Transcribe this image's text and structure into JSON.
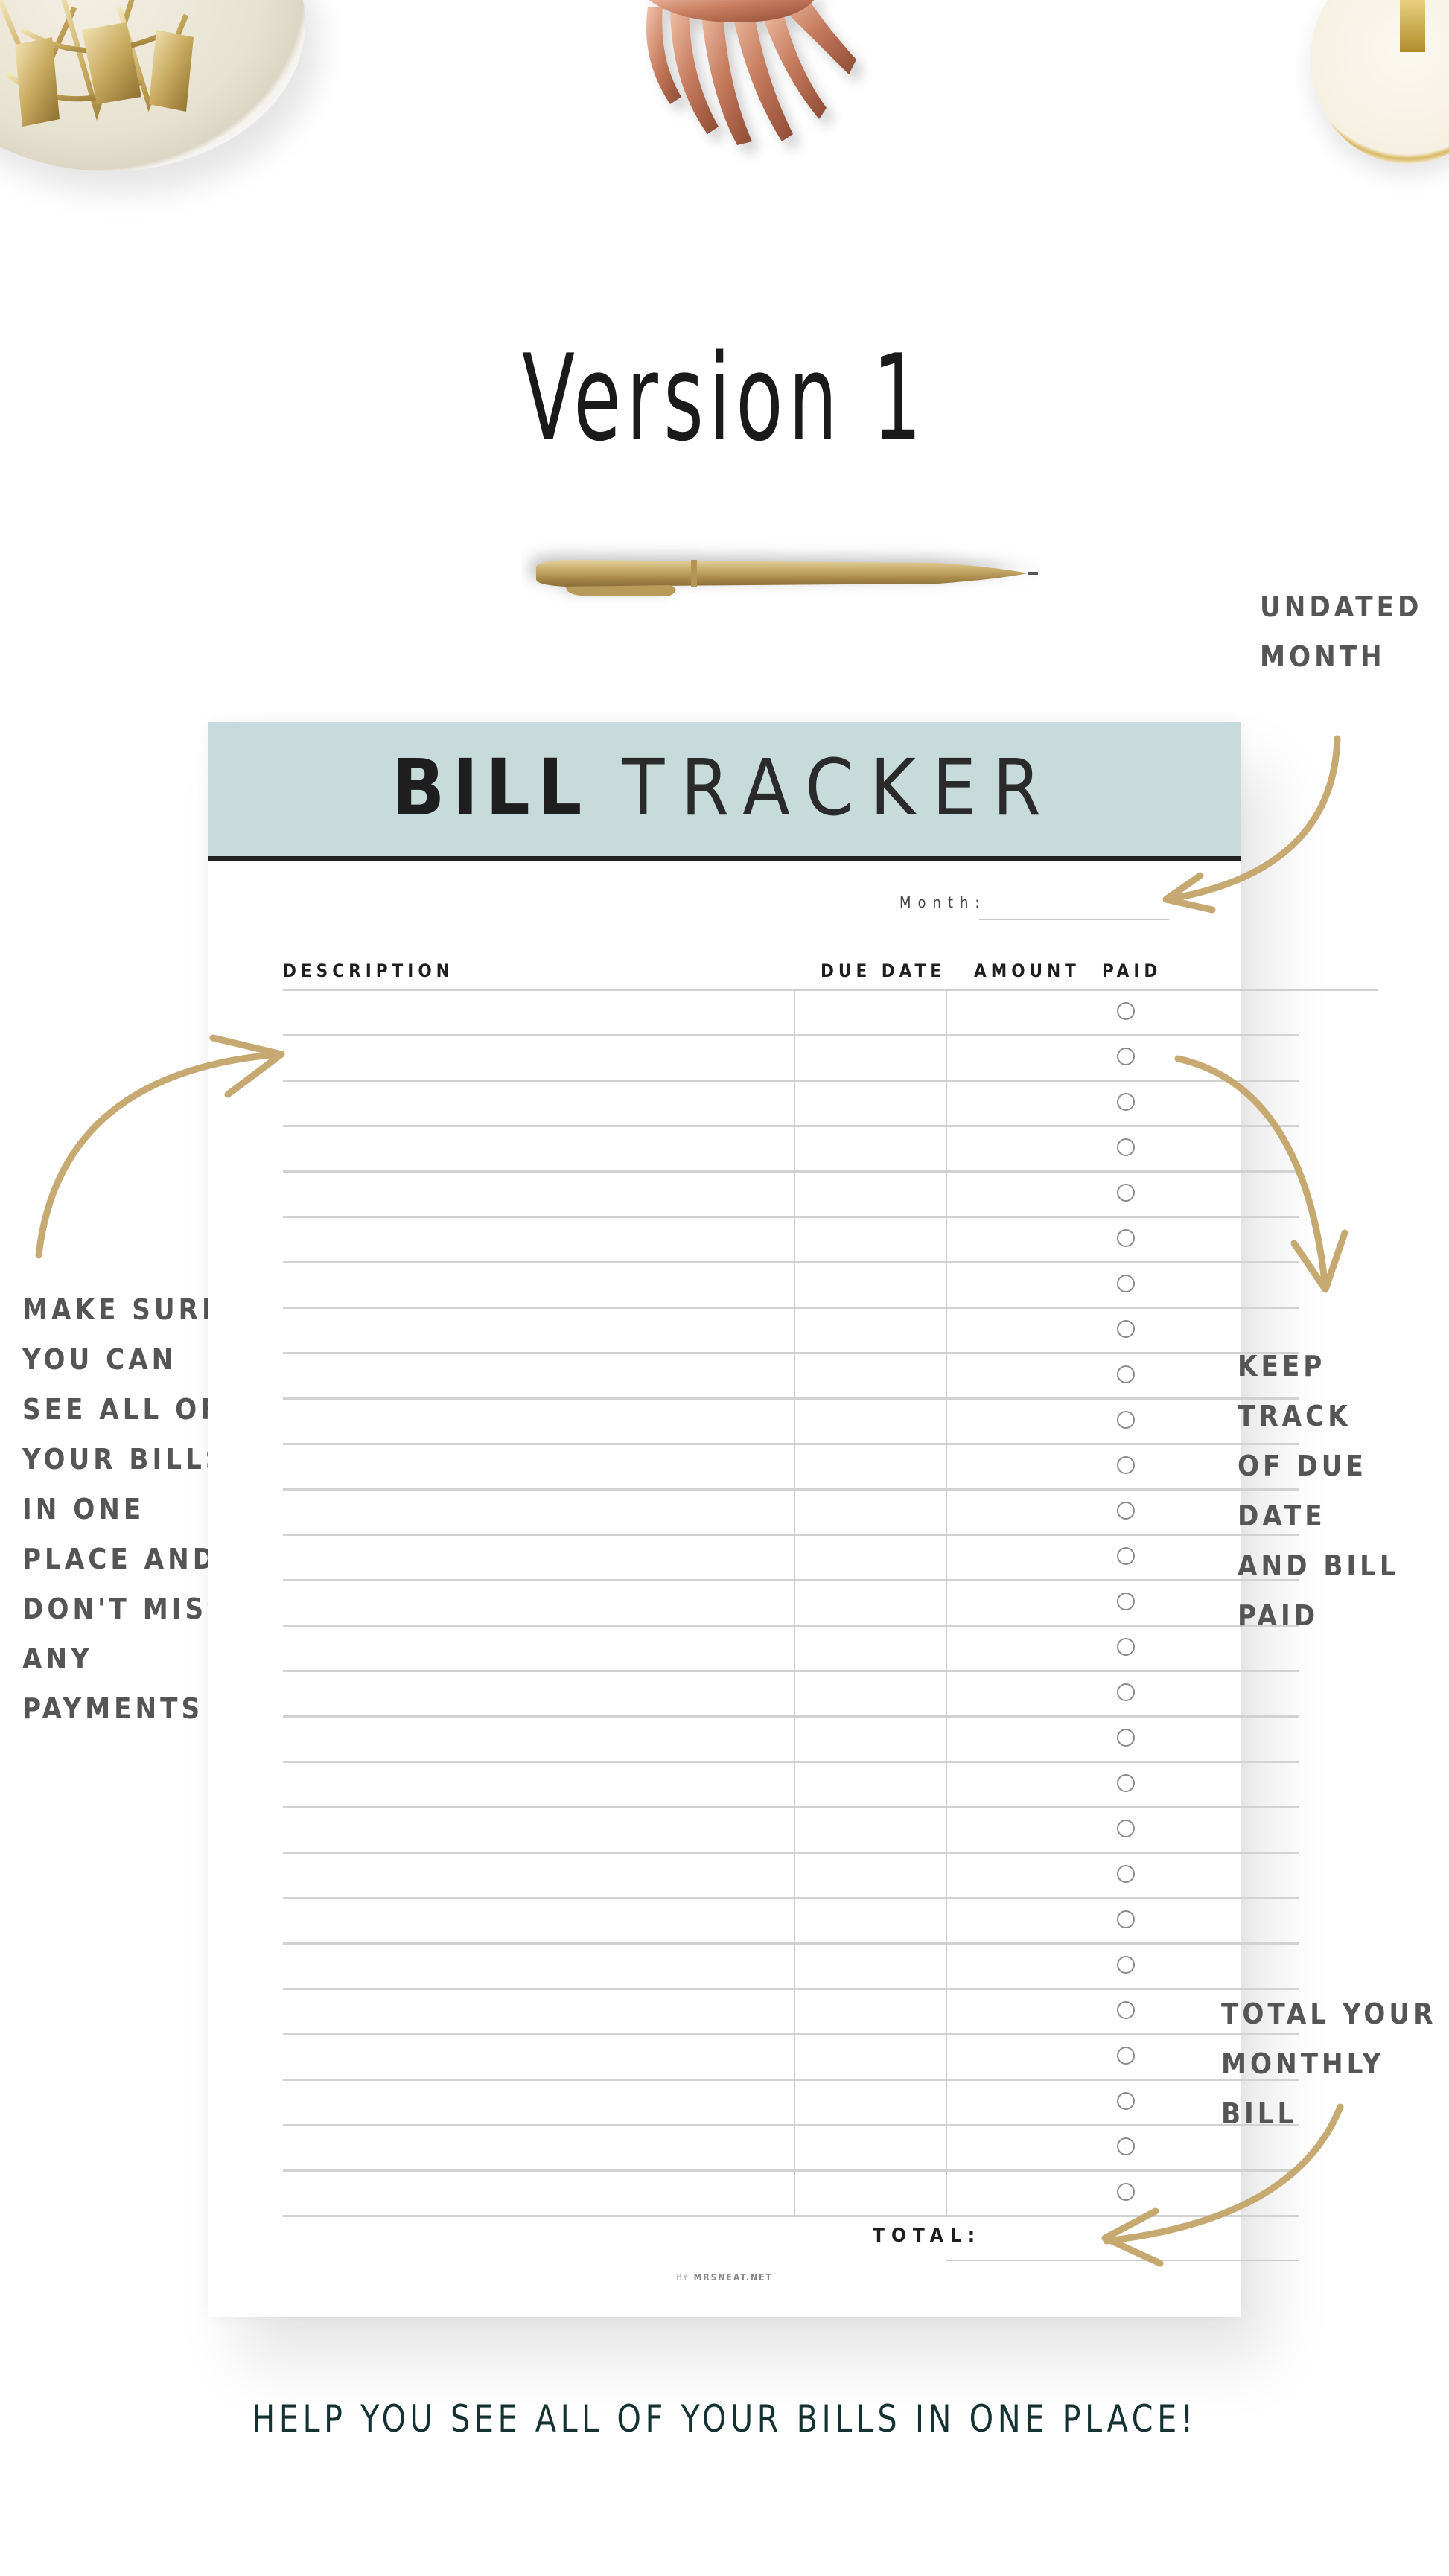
{
  "page": {
    "version_title": "Version 1",
    "tagline": "HELP YOU SEE ALL OF YOUR BILLS IN ONE PLACE!"
  },
  "annotations": {
    "undated_month": [
      "UNDATED",
      "MONTH"
    ],
    "make_sure": [
      "MAKE SURE",
      "YOU CAN",
      "SEE ALL OF",
      "YOUR BILLS",
      "IN ONE",
      "PLACE AND",
      "DON'T MISS",
      "ANY",
      "PAYMENTS"
    ],
    "keep_track": [
      "KEEP TRACK",
      "OF DUE DATE",
      "AND BILL",
      "PAID"
    ],
    "total_your": [
      "TOTAL YOUR",
      "MONTHLY BILL"
    ]
  },
  "tracker": {
    "title_bold": "BILL",
    "title_light": "TRACKER",
    "month_label": "Month:",
    "month_value": "",
    "columns": {
      "description": "DESCRIPTION",
      "due_date": "DUE DATE",
      "amount": "AMOUNT",
      "paid": "PAID"
    },
    "row_count": 27,
    "rows": [],
    "total_label": "TOTAL:",
    "total_value": "",
    "brand_by": "BY",
    "brand_name": "MRSNEAT.NET"
  },
  "colors": {
    "header_band": "#c7dcda",
    "header_rule": "#222222",
    "annotation_text": "#555555",
    "tagline_text": "#143232",
    "arrow_gold": "#c4a46a"
  },
  "decorations": [
    "gold-binder-clips-bowl",
    "rose-gold-monstera-leaf",
    "marble-dish-with-clip",
    "gold-pen"
  ]
}
